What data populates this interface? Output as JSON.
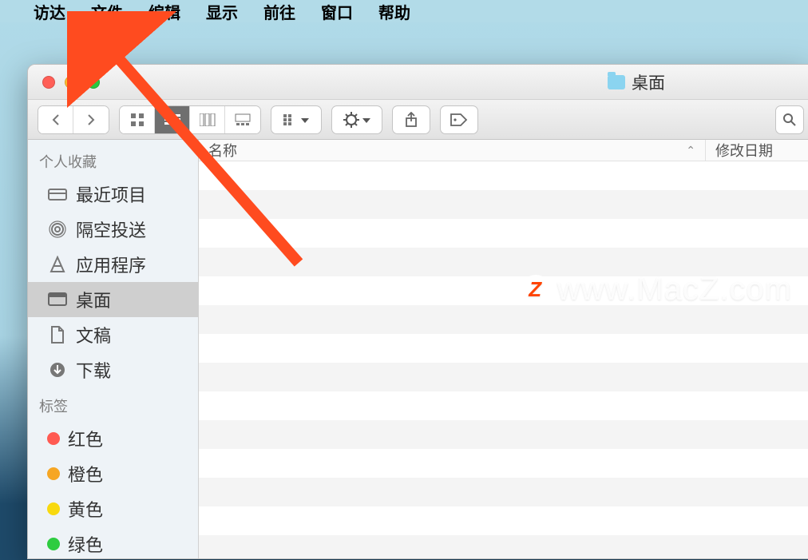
{
  "menubar": {
    "items": [
      "访达",
      "文件",
      "编辑",
      "显示",
      "前往",
      "窗口",
      "帮助"
    ]
  },
  "window": {
    "title": "桌面"
  },
  "sidebar": {
    "favorites_label": "个人收藏",
    "items": [
      {
        "label": "最近项目",
        "icon": "recent"
      },
      {
        "label": "隔空投送",
        "icon": "airdrop"
      },
      {
        "label": "应用程序",
        "icon": "apps"
      },
      {
        "label": "桌面",
        "icon": "desktop",
        "selected": true
      },
      {
        "label": "文稿",
        "icon": "documents"
      },
      {
        "label": "下载",
        "icon": "downloads"
      }
    ],
    "tags_label": "标签",
    "tags": [
      {
        "label": "红色",
        "color": "red"
      },
      {
        "label": "橙色",
        "color": "orange"
      },
      {
        "label": "黄色",
        "color": "yellow"
      },
      {
        "label": "绿色",
        "color": "green"
      }
    ]
  },
  "columns": {
    "name": "名称",
    "date": "修改日期"
  },
  "watermark": "www.MacZ.com"
}
